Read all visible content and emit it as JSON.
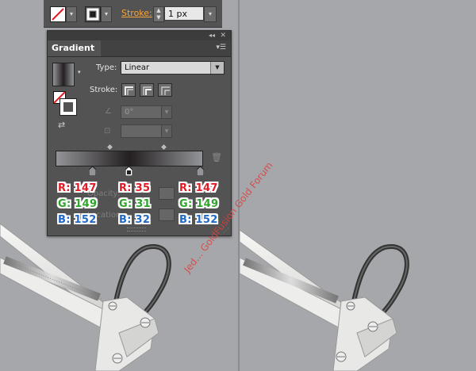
{
  "control_bar": {
    "fill_swatch": "none",
    "stroke_label": "Stroke:",
    "stroke_weight": "1 px"
  },
  "gradient_panel": {
    "tab_title": "Gradient",
    "type_label": "Type:",
    "type_value": "Linear",
    "stroke_label": "Stroke:",
    "angle_value": "0°",
    "aspect_value": "",
    "opacity_label": "Opacity:",
    "location_label": "Location:",
    "gradient_bar_colors": [
      "#939498",
      "#231f20",
      "#939498"
    ]
  },
  "stops": [
    {
      "r_label": "R: 147",
      "g_label": "G: 149",
      "b_label": "B: 152"
    },
    {
      "r_label": "R: 35",
      "g_label": "G: 31",
      "b_label": "B: 32"
    },
    {
      "r_label": "R: 147",
      "g_label": "G: 149",
      "b_label": "B: 152"
    }
  ],
  "colors": {
    "panel_bg": "#535353",
    "canvas_bg": "#a6a7ab",
    "accent_orange": "#f6a53b",
    "r_color": "#e01b25",
    "g_color": "#2ea52a",
    "b_color": "#1f69c8"
  },
  "watermark": "Jed... GoldFusion Gold Forum",
  "icons": [
    "collapse-icon",
    "close-icon",
    "panel-menu-icon",
    "trash-icon",
    "reverse-gradient-icon",
    "angle-icon",
    "aspect-ratio-icon"
  ]
}
